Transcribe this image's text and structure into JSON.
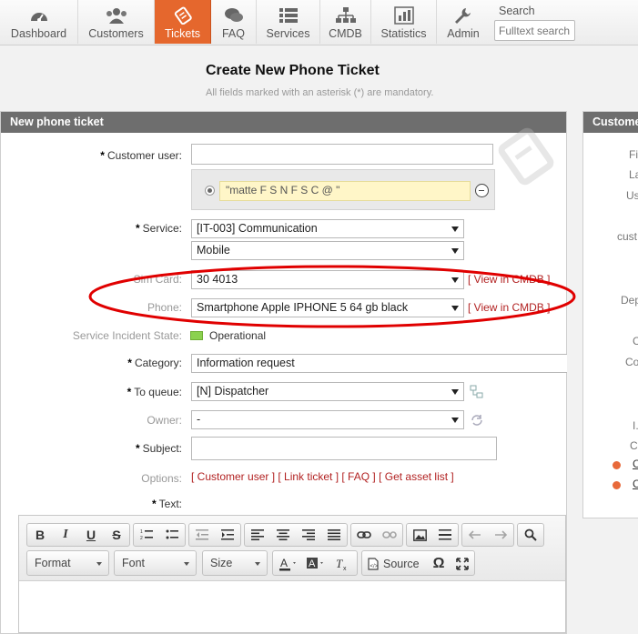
{
  "nav": {
    "items": [
      {
        "label": "Dashboard",
        "icon": "dashboard-icon"
      },
      {
        "label": "Customers",
        "icon": "customers-icon"
      },
      {
        "label": "Tickets",
        "icon": "tickets-icon",
        "active": true
      },
      {
        "label": "FAQ",
        "icon": "faq-icon"
      },
      {
        "label": "Services",
        "icon": "services-icon"
      },
      {
        "label": "CMDB",
        "icon": "cmdb-icon"
      },
      {
        "label": "Statistics",
        "icon": "statistics-icon"
      },
      {
        "label": "Admin",
        "icon": "admin-icon"
      }
    ],
    "search_label": "Search",
    "search_placeholder": "Fulltext search"
  },
  "page": {
    "title": "Create New Phone Ticket",
    "subtitle": "All fields marked with an asterisk (*) are mandatory."
  },
  "panel": {
    "header": "New phone ticket"
  },
  "side_panel": {
    "header": "Customer Information",
    "labels": [
      "Fi",
      "La",
      "Us",
      "cust",
      "Dep",
      "C",
      "Co",
      "I.",
      "C"
    ],
    "links": [
      "C",
      "C"
    ]
  },
  "form": {
    "customer_user_label": "Customer user:",
    "customer_user_value": "",
    "customer_selected": "\"matte  F  S  N    F  S  C  @       \"",
    "service_label": "Service:",
    "service_value": "[IT-003] Communication",
    "subservice_value": "Mobile",
    "sim_card_label": "Sim Card:",
    "sim_card_value": "30    4013",
    "sim_card_link": "[ View in CMDB ]",
    "phone_label": "Phone:",
    "phone_value": "Smartphone Apple IPHONE 5 64 gb black",
    "phone_link": "[ View in CMDB ]",
    "incident_state_label": "Service Incident State:",
    "incident_state_value": "Operational",
    "category_label": "Category:",
    "category_value": "Information request",
    "queue_label": "To queue:",
    "queue_value": "[N] Dispatcher",
    "owner_label": "Owner:",
    "owner_value": "-",
    "subject_label": "Subject:",
    "subject_value": "",
    "options_label": "Options:",
    "options_links": "[ Customer user ] [ Link ticket ] [ FAQ ] [ Get asset list ]",
    "text_label": "Text:"
  },
  "editor": {
    "buttons": [
      "B",
      "I",
      "U",
      "S"
    ],
    "format_label": "Format",
    "font_label": "Font",
    "size_label": "Size",
    "source_label": "Source"
  },
  "colors": {
    "active_tab": "#e5672d",
    "link_red": "#b22222",
    "annotation": "#e00000",
    "status_green": "#8bd14f"
  }
}
